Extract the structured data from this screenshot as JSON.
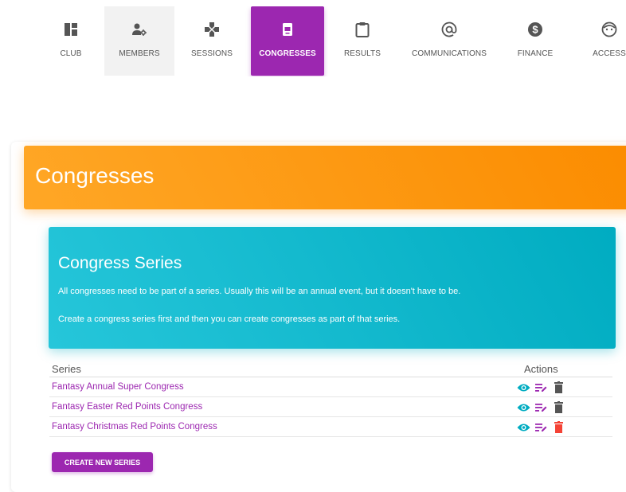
{
  "nav": {
    "items": [
      {
        "label": "CLUB",
        "icon": "dashboard-icon"
      },
      {
        "label": "MEMBERS",
        "icon": "manage-accounts-icon"
      },
      {
        "label": "SESSIONS",
        "icon": "gamepad-icon"
      },
      {
        "label": "CONGRESSES",
        "icon": "congress-icon"
      },
      {
        "label": "RESULTS",
        "icon": "clipboard-icon"
      },
      {
        "label": "COMMUNICATIONS",
        "icon": "at-sign-icon"
      },
      {
        "label": "FINANCE",
        "icon": "dollar-circle-icon"
      },
      {
        "label": "ACCESS",
        "icon": "face-icon"
      }
    ],
    "active": "CONGRESSES",
    "colors": {
      "active_bg": "#9c27b0",
      "hover_bg": "#f2f2f2"
    }
  },
  "page": {
    "title": "Congresses",
    "header_color": "#fb8c00"
  },
  "series_card": {
    "title": "Congress Series",
    "paragraph1": "All congresses need to be part of a series. Usually this will be an annual event, but it doesn't have to be.",
    "paragraph2": "Create a congress series first and then you can create congresses as part of that series.",
    "color": "#00acc1"
  },
  "table": {
    "columns": [
      "Series",
      "Actions"
    ],
    "rows": [
      {
        "name": "Fantasy Annual Super Congress",
        "delete_enabled": false
      },
      {
        "name": "Fantasy Easter Red Points Congress",
        "delete_enabled": false
      },
      {
        "name": "Fantasy Christmas Red Points Congress",
        "delete_enabled": true
      }
    ],
    "action_icons": [
      "view-icon",
      "edit-icon",
      "delete-icon"
    ],
    "colors": {
      "view": "#00acc1",
      "edit": "#9c27b0",
      "delete_disabled": "#555555",
      "delete_enabled": "#f44336"
    }
  },
  "buttons": {
    "create": "CREATE NEW SERIES"
  }
}
